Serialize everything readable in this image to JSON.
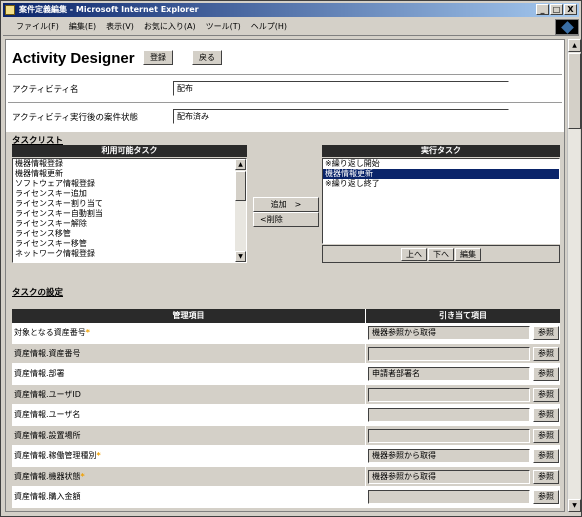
{
  "window": {
    "title": "案件定義編集 - Microsoft Internet Explorer",
    "minimize_label": "_",
    "maximize_label": "□",
    "close_label": "X"
  },
  "menu": {
    "items": [
      "ファイル(F)",
      "編集(E)",
      "表示(V)",
      "お気に入り(A)",
      "ツール(T)",
      "ヘルプ(H)"
    ]
  },
  "header": {
    "title": "Activity Designer",
    "register_label": "登録",
    "back_label": "戻る"
  },
  "form": {
    "activity_name_label": "アクティビティ名",
    "activity_name_value": "配布",
    "post_status_label": "アクティビティ実行後の案件状態",
    "post_status_value": "配布済み"
  },
  "tasklist": {
    "title": "タスクリスト",
    "available_header": "利用可能タスク",
    "available_items": [
      "機器情報登録",
      "機器情報更新",
      "ソフトウェア情報登録",
      "ライセンスキー追加",
      "ライセンスキー割り当て",
      "ライセンスキー自動割当",
      "ライセンスキー解除",
      "ライセンス移管",
      "ライセンスキー移管",
      "ネットワーク情報登録"
    ],
    "add_label": "追加　>",
    "remove_label": "<削除",
    "exec_header": "実行タスク",
    "exec_items": [
      "※繰り返し開始",
      "機器情報更新",
      "※繰り返し終了"
    ],
    "exec_selected_index": 1,
    "up_label": "上へ",
    "down_label": "下へ",
    "edit_label": "編集"
  },
  "task_settings": {
    "title": "タスクの設定",
    "col_item": "管理項目",
    "col_assign": "引き当て項目",
    "ref_label": "参照",
    "rows": [
      {
        "label": "対象となる資産番号",
        "required": true,
        "value": "機器参照から取得"
      },
      {
        "label": "資産情報.資産番号",
        "required": false,
        "value": ""
      },
      {
        "label": "資産情報.部署",
        "required": false,
        "value": "申請者部署名"
      },
      {
        "label": "資産情報.ユーザID",
        "required": false,
        "value": ""
      },
      {
        "label": "資産情報.ユーザ名",
        "required": false,
        "value": ""
      },
      {
        "label": "資産情報.設置場所",
        "required": false,
        "value": ""
      },
      {
        "label": "資産情報.稼働管理種別",
        "required": true,
        "value": "機器参照から取得"
      },
      {
        "label": "資産情報.機器状態",
        "required": true,
        "value": "機器参照から取得"
      },
      {
        "label": "資産情報.購入金額",
        "required": false,
        "value": ""
      }
    ],
    "required_mark": "*"
  }
}
